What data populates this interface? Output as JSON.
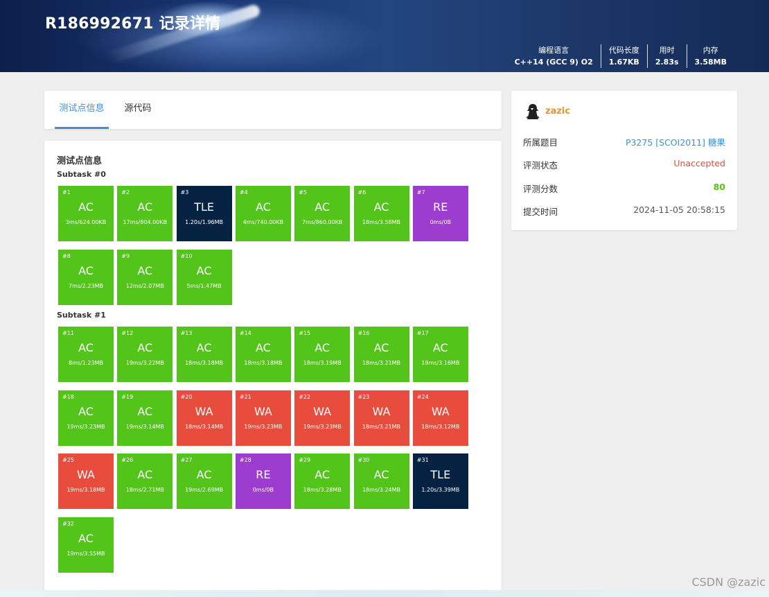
{
  "header": {
    "title": "R186992671 记录详情",
    "stats": [
      {
        "label": "编程语言",
        "value": "C++14 (GCC 9) O2"
      },
      {
        "label": "代码长度",
        "value": "1.67KB"
      },
      {
        "label": "用时",
        "value": "2.83s"
      },
      {
        "label": "内存",
        "value": "3.58MB"
      }
    ]
  },
  "tabs": [
    {
      "label": "测试点信息",
      "active": true
    },
    {
      "label": "源代码",
      "active": false
    }
  ],
  "main": {
    "section_title": "测试点信息",
    "subtasks": [
      {
        "title": "Subtask #0",
        "cases": [
          {
            "num": "#1",
            "status": "AC",
            "detail": "3ms/624.00KB"
          },
          {
            "num": "#2",
            "status": "AC",
            "detail": "17ms/804.00KB"
          },
          {
            "num": "#3",
            "status": "TLE",
            "detail": "1.20s/1.96MB"
          },
          {
            "num": "#4",
            "status": "AC",
            "detail": "4ms/740.00KB"
          },
          {
            "num": "#5",
            "status": "AC",
            "detail": "7ms/860.00KB"
          },
          {
            "num": "#6",
            "status": "AC",
            "detail": "18ms/3.58MB"
          },
          {
            "num": "#7",
            "status": "RE",
            "detail": "0ms/0B"
          },
          {
            "num": "#8",
            "status": "AC",
            "detail": "7ms/2.23MB"
          },
          {
            "num": "#9",
            "status": "AC",
            "detail": "12ms/2.07MB"
          },
          {
            "num": "#10",
            "status": "AC",
            "detail": "5ms/1.47MB"
          }
        ]
      },
      {
        "title": "Subtask #1",
        "cases": [
          {
            "num": "#11",
            "status": "AC",
            "detail": "8ms/1.23MB"
          },
          {
            "num": "#12",
            "status": "AC",
            "detail": "19ms/3.22MB"
          },
          {
            "num": "#13",
            "status": "AC",
            "detail": "18ms/3.18MB"
          },
          {
            "num": "#14",
            "status": "AC",
            "detail": "18ms/3.18MB"
          },
          {
            "num": "#15",
            "status": "AC",
            "detail": "18ms/3.19MB"
          },
          {
            "num": "#16",
            "status": "AC",
            "detail": "18ms/3.21MB"
          },
          {
            "num": "#17",
            "status": "AC",
            "detail": "19ms/3.16MB"
          },
          {
            "num": "#18",
            "status": "AC",
            "detail": "19ms/3.23MB"
          },
          {
            "num": "#19",
            "status": "AC",
            "detail": "19ms/3.14MB"
          },
          {
            "num": "#20",
            "status": "WA",
            "detail": "18ms/3.14MB"
          },
          {
            "num": "#21",
            "status": "WA",
            "detail": "19ms/3.23MB"
          },
          {
            "num": "#22",
            "status": "WA",
            "detail": "19ms/3.23MB"
          },
          {
            "num": "#23",
            "status": "WA",
            "detail": "18ms/3.21MB"
          },
          {
            "num": "#24",
            "status": "WA",
            "detail": "18ms/3.12MB"
          },
          {
            "num": "#25",
            "status": "WA",
            "detail": "19ms/3.18MB"
          },
          {
            "num": "#26",
            "status": "AC",
            "detail": "18ms/2.71MB"
          },
          {
            "num": "#27",
            "status": "AC",
            "detail": "19ms/2.69MB"
          },
          {
            "num": "#28",
            "status": "RE",
            "detail": "0ms/0B"
          },
          {
            "num": "#29",
            "status": "AC",
            "detail": "18ms/3.28MB"
          },
          {
            "num": "#30",
            "status": "AC",
            "detail": "18ms/3.24MB"
          },
          {
            "num": "#31",
            "status": "TLE",
            "detail": "1.20s/3.39MB"
          },
          {
            "num": "#32",
            "status": "AC",
            "detail": "19ms/3.55MB"
          }
        ]
      }
    ]
  },
  "status_colors": {
    "AC": "#52c41a",
    "WA": "#e74c3c",
    "TLE": "#052242",
    "RE": "#9d3dcf"
  },
  "sidebar": {
    "avatar_icon": "user-avatar-icon",
    "username": "zazic",
    "rows": [
      {
        "label": "所属题目",
        "value": "P3275 [SCOI2011] 糖果",
        "color": "#3d8fd8",
        "bold": false
      },
      {
        "label": "评测状态",
        "value": "Unaccepted",
        "color": "#e74c3c",
        "bold": false
      },
      {
        "label": "评测分数",
        "value": "80",
        "color": "#52c41a",
        "bold": true
      },
      {
        "label": "提交时间",
        "value": "2024-11-05 20:58:15",
        "color": "#555555",
        "bold": false
      }
    ]
  },
  "watermark": "CSDN @zazic"
}
